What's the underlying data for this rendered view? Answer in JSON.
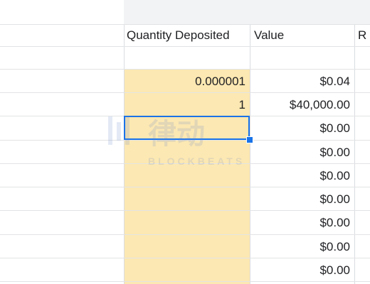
{
  "sheet": {
    "headers": {
      "quantity": "Quantity Deposited",
      "value": "Value",
      "partial_next": "R"
    },
    "rows": [
      {
        "quantity": "0.000001",
        "value": "$0.04"
      },
      {
        "quantity": "1",
        "value": "$40,000.00"
      },
      {
        "quantity": "",
        "value": "$0.00"
      },
      {
        "quantity": "",
        "value": "$0.00"
      },
      {
        "quantity": "",
        "value": "$0.00"
      },
      {
        "quantity": "",
        "value": "$0.00"
      },
      {
        "quantity": "",
        "value": "$0.00"
      },
      {
        "quantity": "",
        "value": "$0.00"
      },
      {
        "quantity": "",
        "value": "$0.00"
      }
    ]
  },
  "watermark": {
    "cjk": "律动",
    "latin": "BLOCKBEATS"
  },
  "colors": {
    "highlight": "#fce8b2",
    "selection": "#1a73e8",
    "gridline": "#dadce0"
  }
}
